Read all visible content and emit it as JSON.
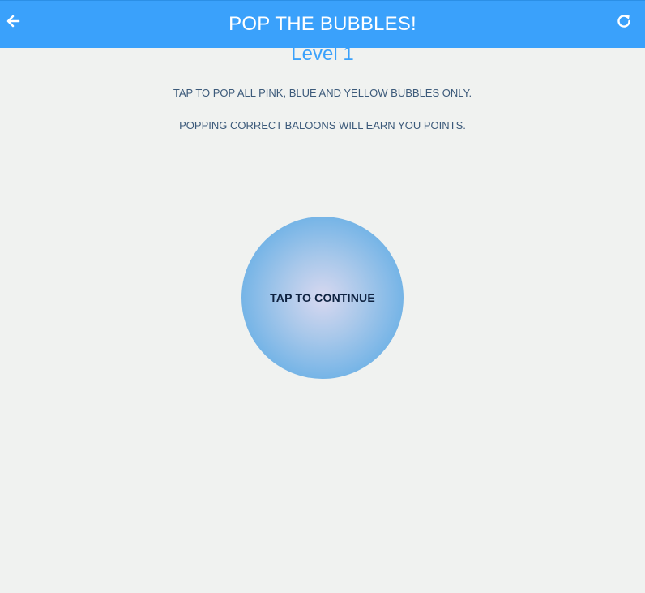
{
  "header": {
    "title": "POP THE BUBBLES!",
    "back_icon": "arrow-left-icon",
    "refresh_icon": "refresh-icon",
    "background_color": "#3aa1fb"
  },
  "main": {
    "level": "Level 1",
    "instruction_1": "TAP TO POP ALL PINK, BLUE AND YELLOW BUBBLES ONLY.",
    "instruction_2": "POPPING CORRECT BALOONS WILL EARN YOU POINTS.",
    "continue_bubble": {
      "label": "TAP TO CONTINUE"
    }
  }
}
